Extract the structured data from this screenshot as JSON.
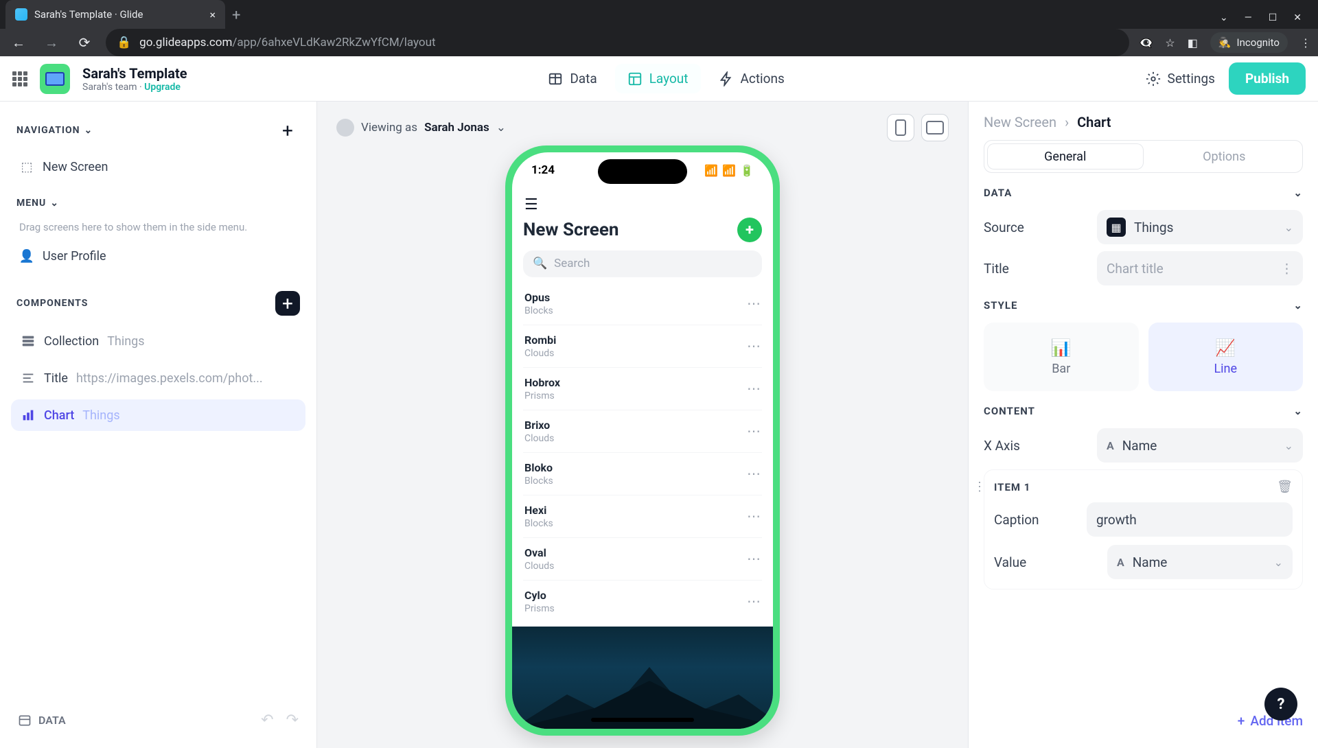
{
  "browser": {
    "tab_title": "Sarah's Template · Glide",
    "url_domain": "go.glideapps.com",
    "url_path": "/app/6ahxeVLdKaw2RkZwYfCM/layout",
    "incognito_label": "Incognito"
  },
  "header": {
    "title": "Sarah's Template",
    "team": "Sarah's team",
    "upgrade": "Upgrade",
    "tabs": {
      "data": "Data",
      "layout": "Layout",
      "actions": "Actions"
    },
    "settings": "Settings",
    "publish": "Publish"
  },
  "left": {
    "navigation_label": "NAVIGATION",
    "nav_items": [
      {
        "label": "New Screen"
      }
    ],
    "menu_label": "MENU",
    "menu_hint": "Drag screens here to show them in the side menu.",
    "menu_items": [
      {
        "label": "User Profile"
      }
    ],
    "components_label": "COMPONENTS",
    "components": [
      {
        "label": "Collection",
        "sub": "Things"
      },
      {
        "label": "Title",
        "sub": "https://images.pexels.com/phot..."
      },
      {
        "label": "Chart",
        "sub": "Things"
      }
    ],
    "data_chip": "DATA"
  },
  "center": {
    "viewing_prefix": "Viewing as",
    "viewing_user": "Sarah Jonas",
    "phone": {
      "time": "1:24",
      "screen_title": "New Screen",
      "search_placeholder": "Search",
      "items": [
        {
          "title": "Opus",
          "sub": "Blocks"
        },
        {
          "title": "Rombi",
          "sub": "Clouds"
        },
        {
          "title": "Hobrox",
          "sub": "Prisms"
        },
        {
          "title": "Brixo",
          "sub": "Clouds"
        },
        {
          "title": "Bloko",
          "sub": "Blocks"
        },
        {
          "title": "Hexi",
          "sub": "Blocks"
        },
        {
          "title": "Oval",
          "sub": "Clouds"
        },
        {
          "title": "Cylo",
          "sub": "Prisms"
        }
      ]
    }
  },
  "right": {
    "crumb_parent": "New Screen",
    "crumb_current": "Chart",
    "seg_general": "General",
    "seg_options": "Options",
    "data_label": "DATA",
    "source_label": "Source",
    "source_value": "Things",
    "title_label": "Title",
    "title_placeholder": "Chart title",
    "style_label": "STYLE",
    "style_bar": "Bar",
    "style_line": "Line",
    "content_label": "CONTENT",
    "xaxis_label": "X Axis",
    "xaxis_value": "Name",
    "item1_label": "ITEM 1",
    "caption_label": "Caption",
    "caption_value": "growth",
    "value_label": "Value",
    "value_value": "Name",
    "add_item": "Add item"
  }
}
